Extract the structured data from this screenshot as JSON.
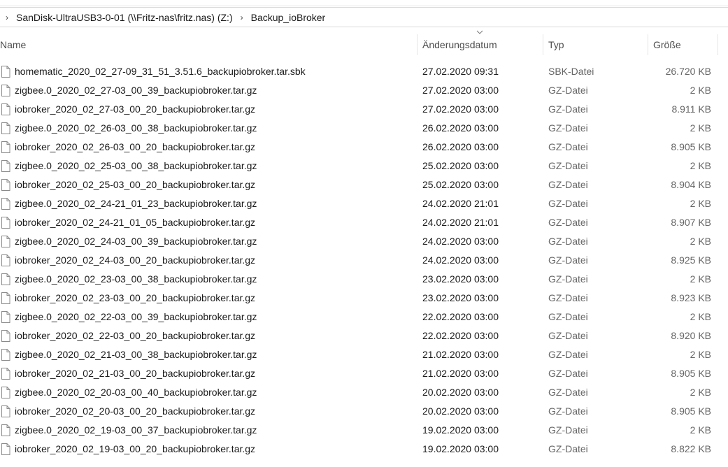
{
  "breadcrumb": {
    "items": [
      "SanDisk-UltraUSB3-0-01 (\\\\Fritz-nas\\fritz.nas) (Z:)",
      "Backup_ioBroker"
    ]
  },
  "columns": {
    "name": "Name",
    "date": "Änderungsdatum",
    "type": "Typ",
    "size": "Größe"
  },
  "files": [
    {
      "name": "homematic_2020_02_27-09_31_51_3.51.6_backupiobroker.tar.sbk",
      "date": "27.02.2020 09:31",
      "type": "SBK-Datei",
      "size": "26.720 KB"
    },
    {
      "name": "zigbee.0_2020_02_27-03_00_39_backupiobroker.tar.gz",
      "date": "27.02.2020 03:00",
      "type": "GZ-Datei",
      "size": "2 KB"
    },
    {
      "name": "iobroker_2020_02_27-03_00_20_backupiobroker.tar.gz",
      "date": "27.02.2020 03:00",
      "type": "GZ-Datei",
      "size": "8.911 KB"
    },
    {
      "name": "zigbee.0_2020_02_26-03_00_38_backupiobroker.tar.gz",
      "date": "26.02.2020 03:00",
      "type": "GZ-Datei",
      "size": "2 KB"
    },
    {
      "name": "iobroker_2020_02_26-03_00_20_backupiobroker.tar.gz",
      "date": "26.02.2020 03:00",
      "type": "GZ-Datei",
      "size": "8.905 KB"
    },
    {
      "name": "zigbee.0_2020_02_25-03_00_38_backupiobroker.tar.gz",
      "date": "25.02.2020 03:00",
      "type": "GZ-Datei",
      "size": "2 KB"
    },
    {
      "name": "iobroker_2020_02_25-03_00_20_backupiobroker.tar.gz",
      "date": "25.02.2020 03:00",
      "type": "GZ-Datei",
      "size": "8.904 KB"
    },
    {
      "name": "zigbee.0_2020_02_24-21_01_23_backupiobroker.tar.gz",
      "date": "24.02.2020 21:01",
      "type": "GZ-Datei",
      "size": "2 KB"
    },
    {
      "name": "iobroker_2020_02_24-21_01_05_backupiobroker.tar.gz",
      "date": "24.02.2020 21:01",
      "type": "GZ-Datei",
      "size": "8.907 KB"
    },
    {
      "name": "zigbee.0_2020_02_24-03_00_39_backupiobroker.tar.gz",
      "date": "24.02.2020 03:00",
      "type": "GZ-Datei",
      "size": "2 KB"
    },
    {
      "name": "iobroker_2020_02_24-03_00_20_backupiobroker.tar.gz",
      "date": "24.02.2020 03:00",
      "type": "GZ-Datei",
      "size": "8.925 KB"
    },
    {
      "name": "zigbee.0_2020_02_23-03_00_38_backupiobroker.tar.gz",
      "date": "23.02.2020 03:00",
      "type": "GZ-Datei",
      "size": "2 KB"
    },
    {
      "name": "iobroker_2020_02_23-03_00_20_backupiobroker.tar.gz",
      "date": "23.02.2020 03:00",
      "type": "GZ-Datei",
      "size": "8.923 KB"
    },
    {
      "name": "zigbee.0_2020_02_22-03_00_39_backupiobroker.tar.gz",
      "date": "22.02.2020 03:00",
      "type": "GZ-Datei",
      "size": "2 KB"
    },
    {
      "name": "iobroker_2020_02_22-03_00_20_backupiobroker.tar.gz",
      "date": "22.02.2020 03:00",
      "type": "GZ-Datei",
      "size": "8.920 KB"
    },
    {
      "name": "zigbee.0_2020_02_21-03_00_38_backupiobroker.tar.gz",
      "date": "21.02.2020 03:00",
      "type": "GZ-Datei",
      "size": "2 KB"
    },
    {
      "name": "iobroker_2020_02_21-03_00_20_backupiobroker.tar.gz",
      "date": "21.02.2020 03:00",
      "type": "GZ-Datei",
      "size": "8.905 KB"
    },
    {
      "name": "zigbee.0_2020_02_20-03_00_40_backupiobroker.tar.gz",
      "date": "20.02.2020 03:00",
      "type": "GZ-Datei",
      "size": "2 KB"
    },
    {
      "name": "iobroker_2020_02_20-03_00_20_backupiobroker.tar.gz",
      "date": "20.02.2020 03:00",
      "type": "GZ-Datei",
      "size": "8.905 KB"
    },
    {
      "name": "zigbee.0_2020_02_19-03_00_37_backupiobroker.tar.gz",
      "date": "19.02.2020 03:00",
      "type": "GZ-Datei",
      "size": "2 KB"
    },
    {
      "name": "iobroker_2020_02_19-03_00_20_backupiobroker.tar.gz",
      "date": "19.02.2020 03:00",
      "type": "GZ-Datei",
      "size": "8.822 KB"
    }
  ],
  "icons": {
    "breadcrumb_separator": "chevron-right-icon",
    "sort_indicator": "sort-descending-icon",
    "file": "file-icon"
  },
  "colors": {
    "background": "#ffffff",
    "text": "#1a1a1a",
    "header_text": "#4d4d4d",
    "secondary_text": "#666666",
    "separator": "#e5e5e5"
  }
}
